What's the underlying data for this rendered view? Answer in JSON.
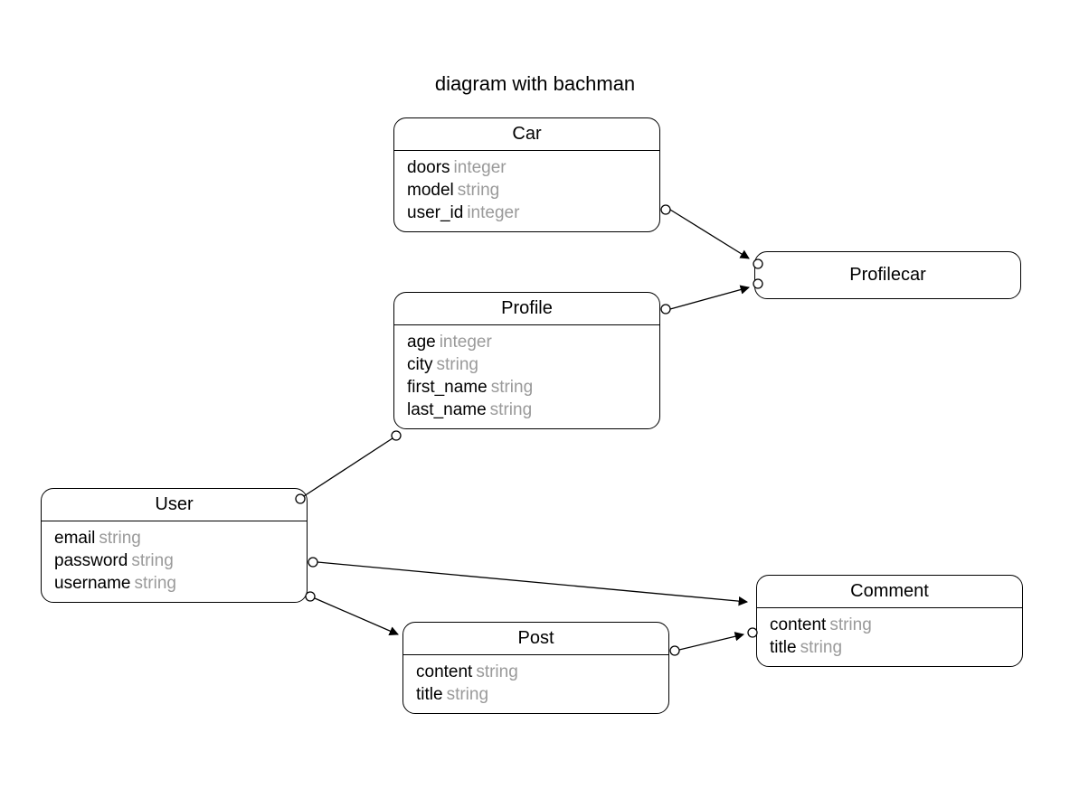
{
  "title": "diagram with bachman",
  "entities": {
    "car": {
      "name": "Car",
      "attrs": [
        {
          "name": "doors",
          "type": "integer"
        },
        {
          "name": "model",
          "type": "string"
        },
        {
          "name": "user_id",
          "type": "integer"
        }
      ]
    },
    "profile": {
      "name": "Profile",
      "attrs": [
        {
          "name": "age",
          "type": "integer"
        },
        {
          "name": "city",
          "type": "string"
        },
        {
          "name": "first_name",
          "type": "string"
        },
        {
          "name": "last_name",
          "type": "string"
        }
      ]
    },
    "profilecar": {
      "name": "Profilecar",
      "attrs": []
    },
    "user": {
      "name": "User",
      "attrs": [
        {
          "name": "email",
          "type": "string"
        },
        {
          "name": "password",
          "type": "string"
        },
        {
          "name": "username",
          "type": "string"
        }
      ]
    },
    "post": {
      "name": "Post",
      "attrs": [
        {
          "name": "content",
          "type": "string"
        },
        {
          "name": "title",
          "type": "string"
        }
      ]
    },
    "comment": {
      "name": "Comment",
      "attrs": [
        {
          "name": "content",
          "type": "string"
        },
        {
          "name": "title",
          "type": "string"
        }
      ]
    }
  },
  "relationships": [
    {
      "from": "car",
      "to": "profilecar"
    },
    {
      "from": "profile",
      "to": "profilecar"
    },
    {
      "from": "user",
      "to": "profile"
    },
    {
      "from": "user",
      "to": "post"
    },
    {
      "from": "user",
      "to": "comment"
    },
    {
      "from": "post",
      "to": "comment"
    }
  ]
}
